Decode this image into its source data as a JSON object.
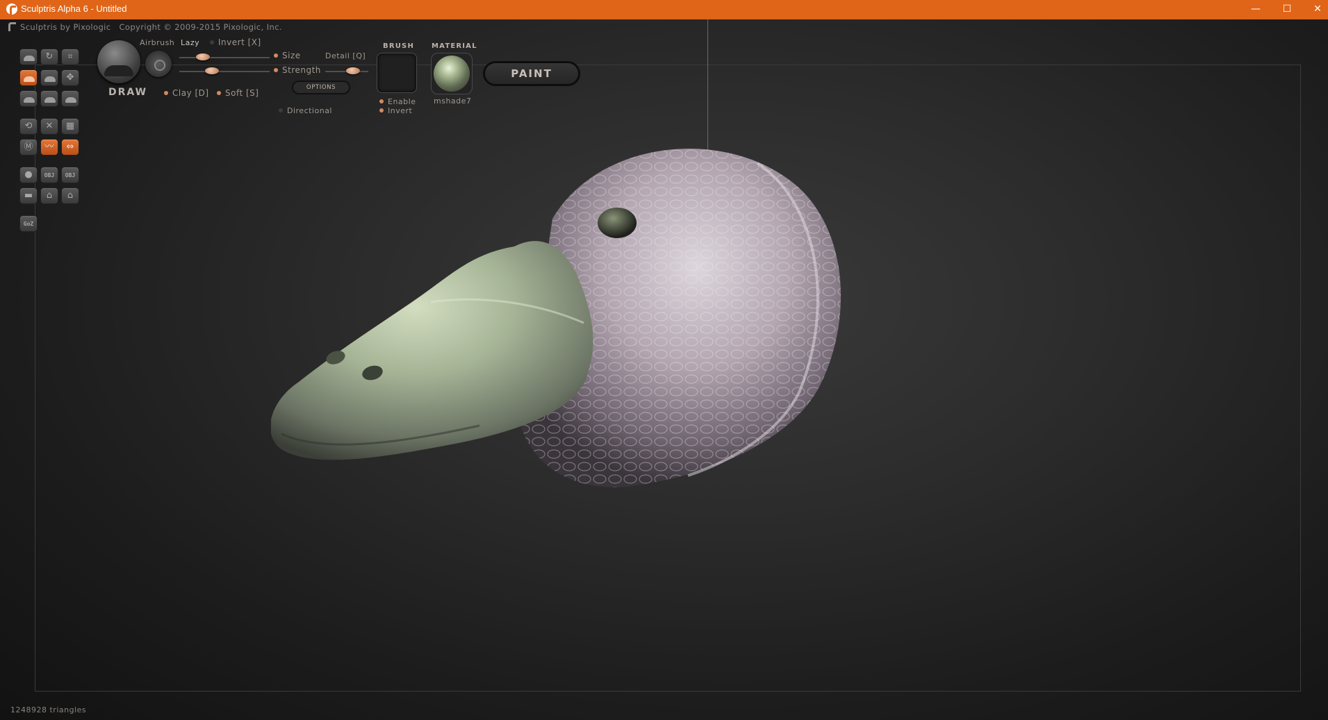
{
  "window": {
    "title": "Sculptris Alpha 6 - Untitled",
    "minimize": "—",
    "maximize": "☐",
    "close": "✕"
  },
  "brand": {
    "name": "Sculptris by Pixologic",
    "copyright": "Copyright © 2009-2015 Pixologic, Inc."
  },
  "tools": {
    "active_brush": "DRAW",
    "goz_label": "GoZ",
    "obj_label": "OBJ",
    "airbrush": "Airbrush",
    "lazy": "Lazy",
    "invert": "Invert [X]",
    "size": "Size",
    "strength": "Strength",
    "detail": "Detail [Q]",
    "options": "OPTIONS",
    "clay": "Clay [D]",
    "soft": "Soft [S]",
    "directional": "Directional"
  },
  "brush_panel": {
    "header": "BRUSH",
    "enable": "Enable",
    "invert": "Invert"
  },
  "material_panel": {
    "header": "MATERIAL",
    "name": "mshade7"
  },
  "paint_button": "PAINT",
  "status": {
    "triangles": "1248928 triangles"
  },
  "colors": {
    "titlebar": "#e06518",
    "accent": "#e3773a",
    "viewport_bg": "#2c2c2c",
    "model_body": "#b8aab4",
    "model_beak": "#a9b89b"
  }
}
